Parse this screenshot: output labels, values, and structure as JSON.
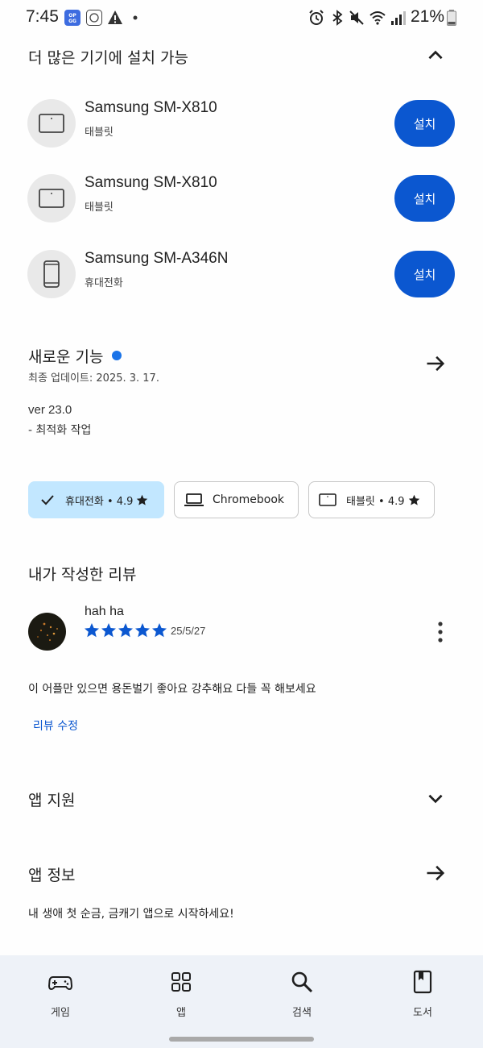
{
  "status_bar": {
    "time": "7:45",
    "battery": "21%",
    "left_icons": [
      "opgg-app-icon",
      "lottery-app-icon",
      "warning-icon",
      "dot-icon"
    ],
    "right_icons": [
      "alarm-icon",
      "bluetooth-icon",
      "mute-icon",
      "wifi-icon",
      "signal-icon",
      "battery-icon"
    ]
  },
  "devices_section": {
    "title": "더 많은 기기에 설치 가능",
    "devices": [
      {
        "name": "Samsung SM-X810",
        "type": "태블릿",
        "icon": "tablet-icon",
        "button": "설치"
      },
      {
        "name": "Samsung SM-X810",
        "type": "태블릿",
        "icon": "tablet-icon",
        "button": "설치"
      },
      {
        "name": "Samsung SM-A346N",
        "type": "휴대전화",
        "icon": "phone-icon",
        "button": "설치"
      }
    ]
  },
  "whats_new": {
    "title": "새로운 기능",
    "updated": "최종 업데이트: 2025. 3. 17.",
    "version": "ver 23.0",
    "note": "- 최적화 작업"
  },
  "chips": [
    {
      "label": "휴대전화 • 4.9",
      "selected": true
    },
    {
      "label": "Chromebook",
      "selected": false
    },
    {
      "label": "태블릿 • 4.9",
      "selected": false
    }
  ],
  "my_review": {
    "title": "내가 작성한 리뷰",
    "author": "hah ha",
    "rating": 5,
    "date": "25/5/27",
    "text": "이 어플만 있으면 용돈벌기 좋아요 강추해요 다들 꼭 해보세요",
    "edit_label": "리뷰 수정"
  },
  "app_support": {
    "title": "앱 지원"
  },
  "app_info": {
    "title": "앱 정보",
    "description": "내 생애 첫 순금, 금캐기 앱으로 시작하세요!"
  },
  "bottom_nav": [
    {
      "label": "게임",
      "icon": "gamepad-icon"
    },
    {
      "label": "앱",
      "icon": "apps-grid-icon"
    },
    {
      "label": "검색",
      "icon": "search-icon"
    },
    {
      "label": "도서",
      "icon": "book-icon"
    }
  ],
  "colors": {
    "accent": "#0b57d0",
    "chip_selected": "#c2e7ff",
    "dot_blue": "#1a73e8",
    "nav_bg": "#eef2f8"
  }
}
